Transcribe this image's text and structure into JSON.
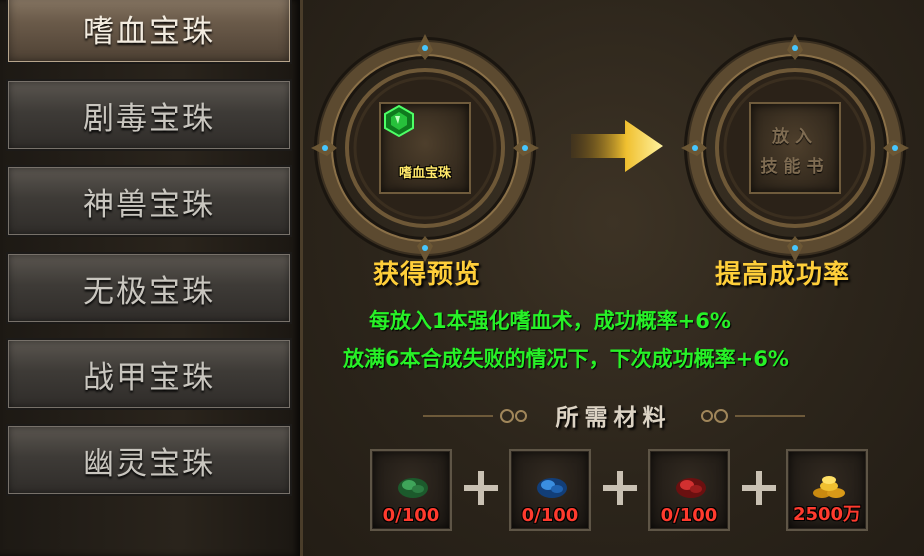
{
  "tabs": [
    {
      "label": "嗜血宝珠",
      "active": true
    },
    {
      "label": "剧毒宝珠",
      "active": false
    },
    {
      "label": "神兽宝珠",
      "active": false
    },
    {
      "label": "无极宝珠",
      "active": false
    },
    {
      "label": "战甲宝珠",
      "active": false
    },
    {
      "label": "幽灵宝珠",
      "active": false
    }
  ],
  "preview": {
    "item_label": "嗜血宝珠",
    "caption": "获得预览"
  },
  "boost": {
    "placeholder_line1": "放入",
    "placeholder_line2": "技能书",
    "caption": "提高成功率"
  },
  "info_lines": [
    "每放入1本强化嗜血术，成功概率+6%",
    "放满6本合成失败的情况下，下次成功概率+6%"
  ],
  "materials": {
    "title": "所需材料",
    "items": [
      {
        "icon": "green-ore-icon",
        "count": "0/100"
      },
      {
        "icon": "blue-ore-icon",
        "count": "0/100"
      },
      {
        "icon": "red-ore-icon",
        "count": "0/100"
      },
      {
        "icon": "gold-coins-icon",
        "count": "2500万"
      }
    ]
  },
  "colors": {
    "green_text": "#27f127",
    "gold_caption": "#ffcf3a",
    "count_red": "#ff3b2e",
    "item_label_yellow": "#ffe86a"
  }
}
